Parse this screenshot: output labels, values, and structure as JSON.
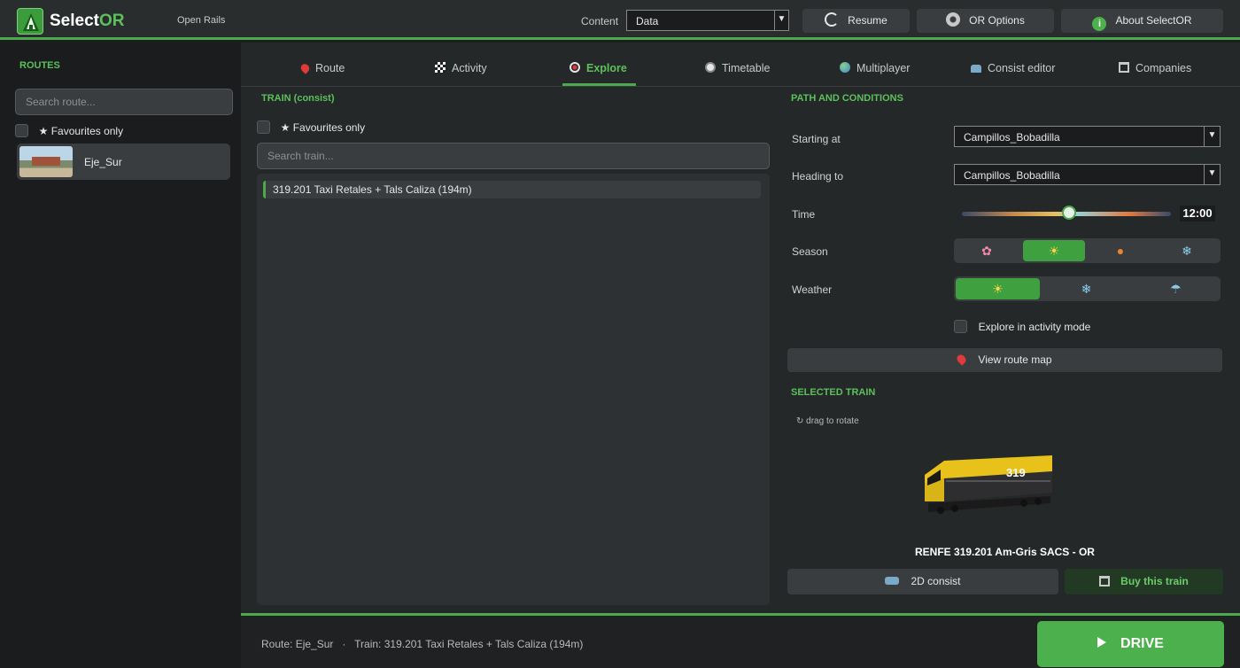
{
  "topbar": {
    "app_name_1": "Select",
    "app_name_2": "OR",
    "subtitle": "Open Rails",
    "content_label": "Content",
    "content_value": "Data",
    "resume": "Resume",
    "or_options": "OR Options",
    "about": "About SelectOR"
  },
  "sidebar": {
    "title": "ROUTES",
    "search_placeholder": "Search route...",
    "favourites": "★  Favourites only",
    "routes": [
      "Eje_Sur"
    ]
  },
  "tabs": [
    {
      "label": "Route",
      "icon": "pin-icon"
    },
    {
      "label": "Activity",
      "icon": "flag-icon"
    },
    {
      "label": "Explore",
      "icon": "explore-icon",
      "active": true
    },
    {
      "label": "Timetable",
      "icon": "clock-icon"
    },
    {
      "label": "Multiplayer",
      "icon": "globe-icon"
    },
    {
      "label": "Consist editor",
      "icon": "train-icon"
    },
    {
      "label": "Companies",
      "icon": "building-icon"
    }
  ],
  "train": {
    "title": "TRAIN (consist)",
    "favourites": "★  Favourites only",
    "search_placeholder": "Search train...",
    "items": [
      "319.201 Taxi Retales + Tals Caliza (194m)"
    ]
  },
  "path": {
    "title": "PATH AND CONDITIONS",
    "starting_label": "Starting at",
    "starting_value": "Campillos_Bobadilla",
    "heading_label": "Heading to",
    "heading_value": "Campillos_Bobadilla",
    "time_label": "Time",
    "time_value": "12:00",
    "time_fraction": 0.5,
    "season_label": "Season",
    "seasons": [
      "spring",
      "summer",
      "autumn",
      "winter"
    ],
    "season_selected": "summer",
    "weather_label": "Weather",
    "weathers": [
      "clear",
      "snow",
      "rain"
    ],
    "weather_selected": "clear",
    "explore_activity": "Explore in activity mode",
    "view_map": "View route map"
  },
  "selected": {
    "title": "SELECTED TRAIN",
    "drag_hint": "↻ drag to rotate",
    "name": "RENFE 319.201 Am-Gris SACS - OR",
    "loco_number": "319",
    "consist_2d": "2D consist",
    "buy": "Buy this train"
  },
  "bottom": {
    "status": "Route: Eje_Sur   ·   Train: 319.201 Taxi Retales + Tals Caliza (194m)",
    "drive": "DRIVE"
  },
  "colors": {
    "accent": "#4caa4c",
    "accent_text": "#5cc05c",
    "panel": "#252829",
    "sidebar": "#1a1c1d"
  }
}
